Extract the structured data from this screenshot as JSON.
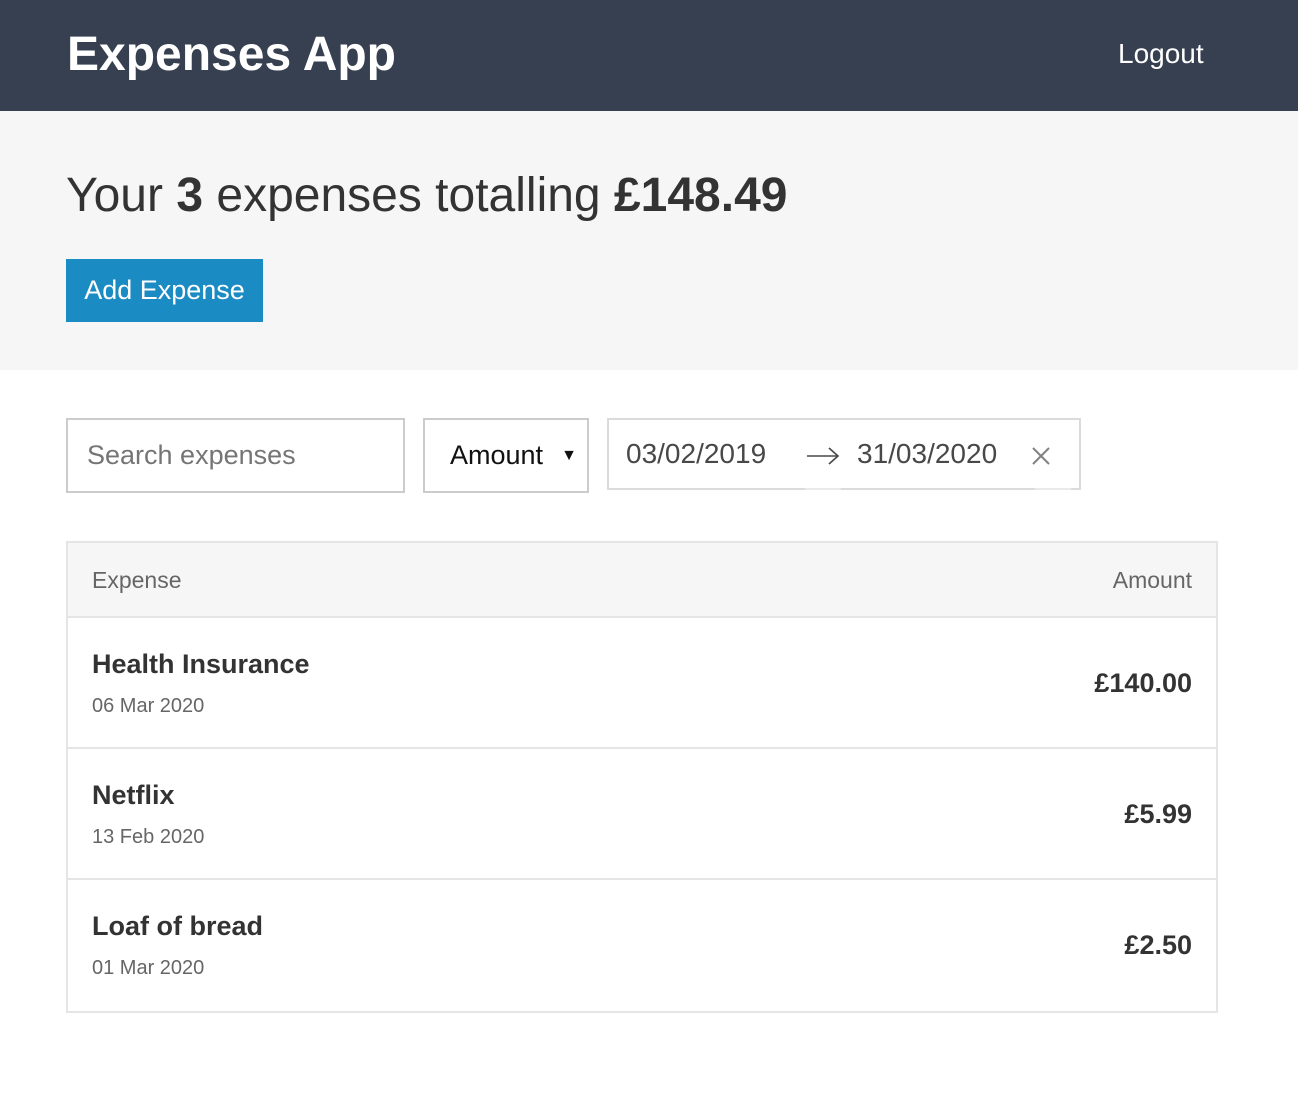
{
  "header": {
    "title": "Expenses App",
    "logout_label": "Logout"
  },
  "summary": {
    "prefix": "Your ",
    "count": "3",
    "middle": " expenses totalling ",
    "total": "£148.49",
    "add_label": "Add Expense"
  },
  "filters": {
    "search_placeholder": "Search expenses",
    "search_value": "",
    "sort_selected": "Amount",
    "start_date": "03/02/2019",
    "end_date": "31/03/2020"
  },
  "table": {
    "col_expense": "Expense",
    "col_amount": "Amount",
    "rows": [
      {
        "description": "Health Insurance",
        "date": "06 Mar 2020",
        "amount": "£140.00"
      },
      {
        "description": "Netflix",
        "date": "13 Feb 2020",
        "amount": "£5.99"
      },
      {
        "description": "Loaf of bread",
        "date": "01 Mar 2020",
        "amount": "£2.50"
      }
    ]
  },
  "icons": {
    "sort": "triangle-down-icon",
    "range": "arrow-right-icon",
    "clear": "close-icon"
  },
  "colors": {
    "header_bg": "#364051",
    "summary_bg": "#f6f6f6",
    "accent": "#1b8bc3"
  }
}
